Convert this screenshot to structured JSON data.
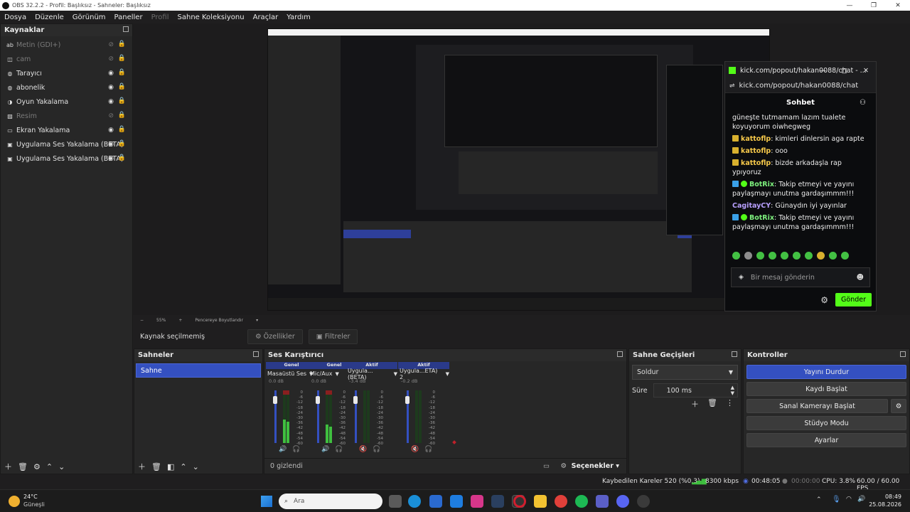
{
  "window": {
    "title": "OBS 32.2.2 - Profil: Başlıksız - Sahneler: Başlıksız"
  },
  "menu": [
    "Dosya",
    "Düzenle",
    "Görünüm",
    "Paneller",
    "Profil",
    "Sahne Koleksiyonu",
    "Araçlar",
    "Yardım"
  ],
  "sources": {
    "title": "Kaynaklar",
    "items": [
      {
        "label": "Metin (GDI+)",
        "icon": "text-icon",
        "visible": false
      },
      {
        "label": "cam",
        "icon": "camera-icon",
        "visible": false
      },
      {
        "label": "Tarayıcı",
        "icon": "globe-icon",
        "visible": true
      },
      {
        "label": "abonelik",
        "icon": "globe-icon",
        "visible": true
      },
      {
        "label": "Oyun Yakalama",
        "icon": "gamepad-icon",
        "visible": true
      },
      {
        "label": "Resim",
        "icon": "image-icon",
        "visible": false
      },
      {
        "label": "Ekran Yakalama",
        "icon": "monitor-icon",
        "visible": true
      },
      {
        "label": "Uygulama Ses Yakalama (BETA)",
        "icon": "window-icon",
        "visible": true
      },
      {
        "label": "Uygulama Ses Yakalama (BETA)",
        "icon": "window-icon",
        "visible": true
      }
    ]
  },
  "preview": {
    "zoom": "55%",
    "fit_label": "Pencereye Boyutlandır"
  },
  "selection": {
    "label": "Kaynak seçilmemiş",
    "properties": "Özellikler",
    "filters": "Filtreler"
  },
  "scenes": {
    "title": "Sahneler",
    "items": [
      "Sahne"
    ]
  },
  "mixer": {
    "title": "Ses Karıştırıcı",
    "hidden_label": "0 gizlendi",
    "options_label": "Seçenekler",
    "scale": [
      "0",
      "-6",
      "-12",
      "-18",
      "-24",
      "-30",
      "-36",
      "-42",
      "-48",
      "-54",
      "-60"
    ],
    "channels": [
      {
        "tag": "Genel",
        "name": "Masaüstü Ses",
        "db": "0.0 dB",
        "level": 0.45,
        "muted": false
      },
      {
        "tag": "Genel",
        "name": "Mic/Aux",
        "db": "0.0 dB",
        "level": 0.35,
        "muted": false
      },
      {
        "tag": "Aktif",
        "name": "Uygula...(BETA)",
        "db": "-3.4 dB",
        "level": 0.0,
        "muted": true
      },
      {
        "tag": "Aktif",
        "name": "Uygula...ETA) 2",
        "db": "-0.2 dB",
        "level": 0.0,
        "muted": true
      }
    ]
  },
  "transitions": {
    "title": "Sahne Geçişleri",
    "selected": "Soldur",
    "duration_label": "Süre",
    "duration": "100 ms"
  },
  "controls": {
    "title": "Kontroller",
    "stop_stream": "Yayını Durdur",
    "start_record": "Kaydı Başlat",
    "virtual_cam": "Sanal Kamerayı Başlat",
    "studio_mode": "Stüdyo Modu",
    "settings": "Ayarlar"
  },
  "status": {
    "dropped": "Kaybedilen Kareler 520 (%0.3)",
    "bitrate": "8300 kbps",
    "stream_time": "00:48:05",
    "rec_time": "00:00:00",
    "cpu": "CPU: 3.8%",
    "fps": "60.00 / 60.00 FPS"
  },
  "chat": {
    "window_title": "kick.com/popout/hakan0088/chat - ...",
    "url": "kick.com/popout/hakan0088/chat",
    "header": "Sohbet",
    "messages": [
      {
        "user": "",
        "text": "güneşte tutmamam lazım tualete koyuyorum oiwhegweg",
        "kind": "plain"
      },
      {
        "user": "kattoflp",
        "text": ": kimleri dinlersin aga rapte",
        "kind": "sub"
      },
      {
        "user": "kattoflp",
        "text": ": ooo",
        "kind": "sub"
      },
      {
        "user": "kattoflp",
        "text": ": bizde arkadaşla rap ypıyoruz",
        "kind": "sub"
      },
      {
        "user": "BotRix",
        "text": ": Takip etmeyi ve yayını paylaşmayı unutma gardaşımmm!!!",
        "kind": "bot"
      },
      {
        "user": "CagitayCY",
        "text": ": Günaydın iyi yayınlar",
        "kind": "user"
      },
      {
        "user": "BotRix",
        "text": ": Takip etmeyi ve yayını paylaşmayı unutma gardaşımmm!!!",
        "kind": "bot"
      }
    ],
    "input_placeholder": "Bir mesaj gönderin",
    "send": "Gönder"
  },
  "weather": {
    "temp": "24°C",
    "desc": "Güneşli"
  },
  "search": {
    "placeholder": "Ara"
  },
  "clock": {
    "time": "08:49",
    "date": "25.08.2026"
  },
  "colors": {
    "accent": "#3450c0",
    "kick_green": "#53fc18",
    "panel": "#272727"
  }
}
